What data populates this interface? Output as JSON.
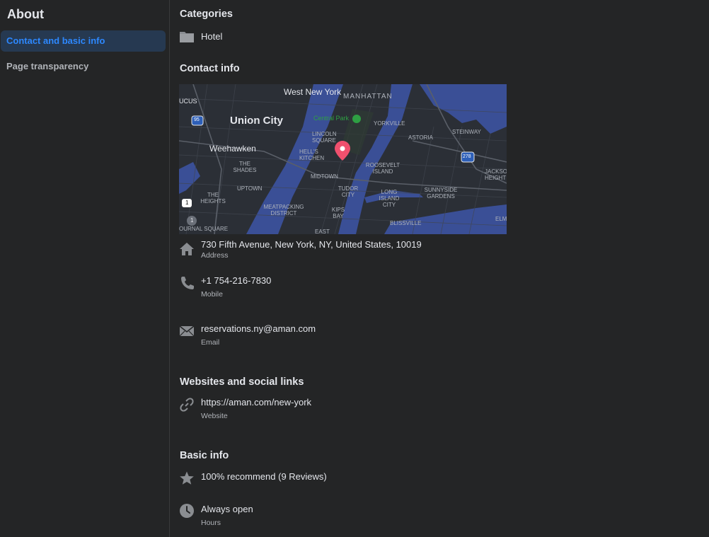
{
  "sidebar": {
    "title": "About",
    "items": [
      {
        "label": "Contact and basic info"
      },
      {
        "label": "Page transparency"
      }
    ]
  },
  "categories": {
    "title": "Categories",
    "value": "Hotel"
  },
  "contact": {
    "title": "Contact info",
    "map": {
      "labels": {
        "west_new_york": "West New York",
        "manhattan": "MANHATTAN",
        "ucus": "UCUS",
        "union_city": "Union City",
        "central_park": "Central Park",
        "yorkville": "YORKVILLE",
        "astoria": "ASTORIA",
        "steinway": "STEINWAY",
        "lincoln_square": "LINCOLN SQUARE",
        "weehawken": "Weehawken",
        "hells_kitchen": "HELL'S KITCHEN",
        "the_shades": "THE SHADES",
        "roosevelt_island": "ROOSEVELT ISLAND",
        "jackson_heights": "JACKSO HEIGHT",
        "midtown": "MIDTOWN",
        "uptown": "UPTOWN",
        "tudor_city": "TUDOR CITY",
        "long_island_city": "LONG ISLAND CITY",
        "sunnyside_gardens": "SUNNYSIDE GARDENS",
        "the_heights": "THE HEIGHTS",
        "meatpacking": "MEATPACKING DISTRICT",
        "kips_bay": "KIPS BAY",
        "journal_square": "OURNAL SQUARE",
        "blissville": "BLISSVILLE",
        "elm": "ELM",
        "east": "EAST",
        "i95": "95",
        "i278": "278",
        "us1": "1",
        "r1": "1"
      }
    },
    "address": {
      "value": "730 Fifth Avenue, New York, NY, United States, 10019",
      "label": "Address"
    },
    "phone": {
      "value": "+1 754-216-7830",
      "label": "Mobile"
    },
    "email": {
      "value": "reservations.ny@aman.com",
      "label": "Email"
    }
  },
  "websites": {
    "title": "Websites and social links",
    "website": {
      "value": "https://aman.com/new-york",
      "label": "Website"
    }
  },
  "basic": {
    "title": "Basic info",
    "rating": {
      "value": "100% recommend (9 Reviews)"
    },
    "hours": {
      "value": "Always open",
      "label": "Hours"
    }
  },
  "colors": {
    "background": "#242526",
    "accent": "#2d88ff",
    "active_bg": "#263951",
    "map_water": "#3a4f96",
    "map_land": "#2b2f36",
    "pin": "#f0506e",
    "park_green": "#2ea043"
  },
  "icons": {
    "category": "folder-icon",
    "address": "home-icon",
    "phone": "phone-icon",
    "email": "envelope-icon",
    "website": "link-icon",
    "rating": "star-icon",
    "hours": "clock-icon"
  }
}
